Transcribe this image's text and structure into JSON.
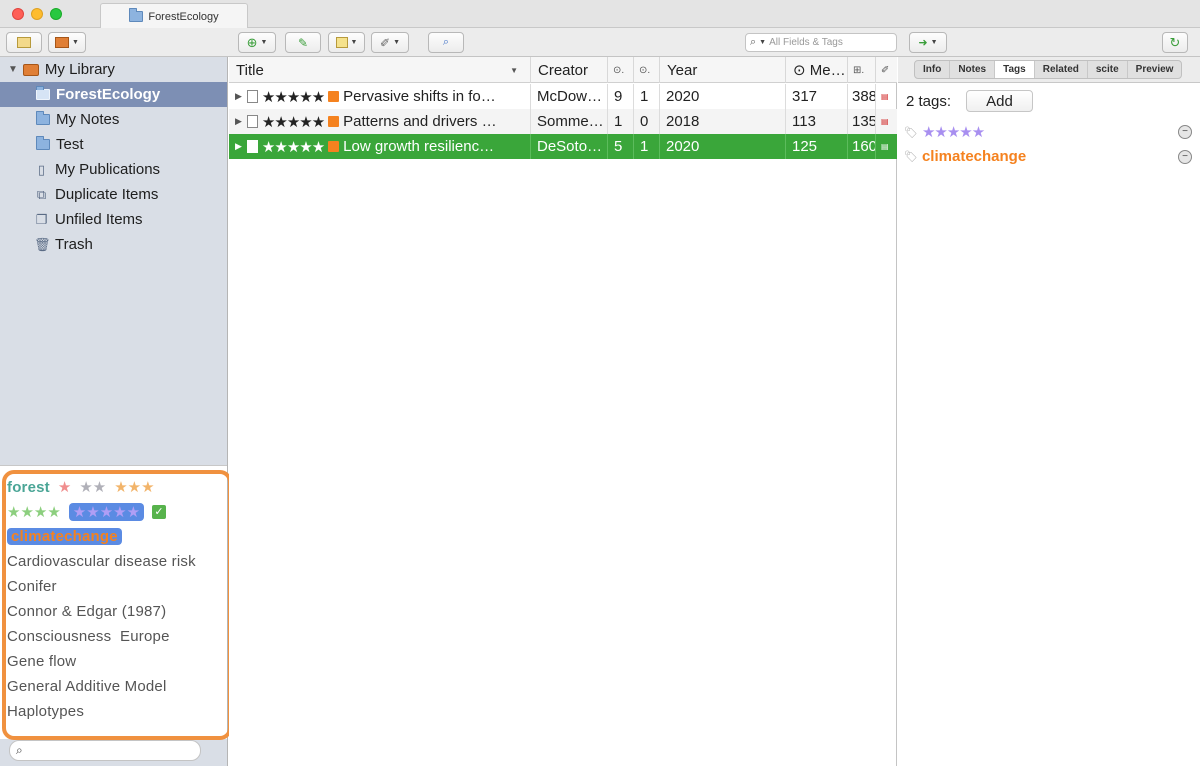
{
  "window": {
    "tab_title": "ForestEcology"
  },
  "toolbar": {
    "search_placeholder": "All Fields & Tags"
  },
  "collections": {
    "library": "My Library",
    "items": [
      {
        "label": "ForestEcology",
        "icon": "folder-icon",
        "selected": true
      },
      {
        "label": "My Notes",
        "icon": "folder-icon"
      },
      {
        "label": "Test",
        "icon": "folder-icon"
      },
      {
        "label": "My Publications",
        "icon": "document-icon"
      },
      {
        "label": "Duplicate Items",
        "icon": "duplicate-icon"
      },
      {
        "label": "Unfiled Items",
        "icon": "unfiled-icon"
      },
      {
        "label": "Trash",
        "icon": "trash-icon"
      }
    ]
  },
  "tag_selector": {
    "tag_forest": "forest",
    "stars_1": "★",
    "stars_2": "★★",
    "stars_3": "★★★",
    "stars_4": "★★★★",
    "stars_5": "★★★★★",
    "check": "✓",
    "tag_climatechange": "climatechange",
    "tags": [
      "Cardiovascular disease risk",
      "Conifer",
      "Connor & Edgar (1987)",
      "Consciousness  Europe",
      "Gene flow",
      "General Additive Model",
      "Haplotypes"
    ]
  },
  "items_table": {
    "columns": {
      "title": "Title",
      "creator": "Creator",
      "col_a": "⊙.",
      "col_b": "⊙.",
      "year": "Year",
      "media": "⊙ Me…",
      "col_c": "⊞."
    },
    "rows": [
      {
        "stars": "★★★★★",
        "title": "Pervasive shifts in fo…",
        "creator": "McDow…",
        "a": "9",
        "b": "1",
        "year": "2020",
        "media": "317",
        "extra": "388",
        "selected": false
      },
      {
        "stars": "★★★★★",
        "title": "Patterns and drivers …",
        "creator": "Somme…",
        "a": "1",
        "b": "0",
        "year": "2018",
        "media": "113",
        "extra": "135",
        "selected": false
      },
      {
        "stars": "★★★★★",
        "title": "Low growth resilienc…",
        "creator": "DeSoto…",
        "a": "5",
        "b": "1",
        "year": "2020",
        "media": "125",
        "extra": "160",
        "selected": true
      }
    ]
  },
  "item_pane": {
    "tabs": [
      "Info",
      "Notes",
      "Tags",
      "Related",
      "scite",
      "Preview"
    ],
    "active_tab": "Tags",
    "tag_count": "2 tags:",
    "add_label": "Add",
    "tags": [
      {
        "label": "★★★★★",
        "color": "#a88ff0"
      },
      {
        "label": "climatechange",
        "color": "#f5821f"
      }
    ]
  },
  "colors": {
    "selection_green": "#3aa63a",
    "sidebar_selected": "#7d8fb4",
    "annotation_orange": "#f0913f"
  }
}
